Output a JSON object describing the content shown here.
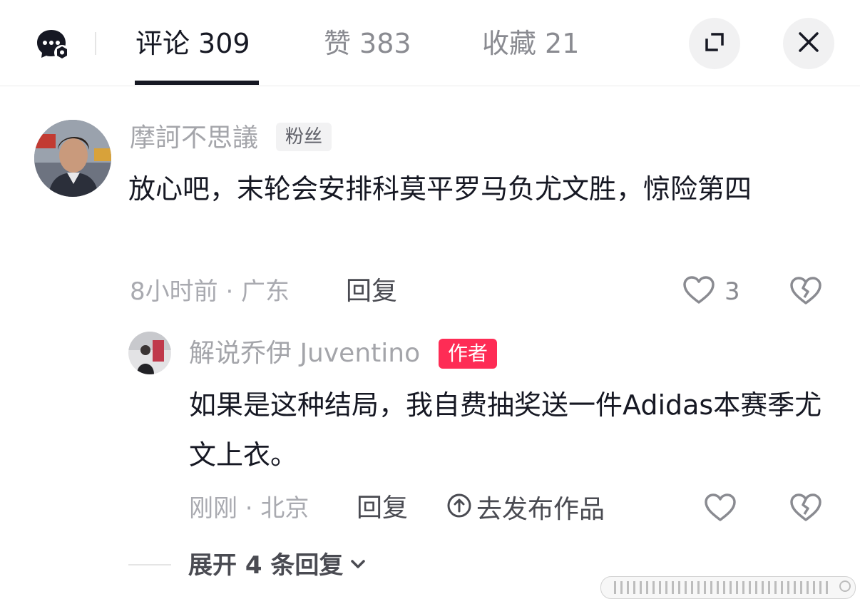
{
  "header": {
    "tabs": [
      {
        "label": "评论",
        "count": "309"
      },
      {
        "label": "赞",
        "count": "383"
      },
      {
        "label": "收藏",
        "count": "21"
      }
    ]
  },
  "comments": [
    {
      "username": "摩訶不思議",
      "badge": "粉丝",
      "text": "放心吧，末轮会安排科莫平罗马负尤文胜，惊险第四",
      "meta": "8小时前 · 广东",
      "reply_label": "回复",
      "like_count": "3"
    }
  ],
  "reply": {
    "username": "解说乔伊 Juventino",
    "badge": "作者",
    "text": "如果是这种结局，我自费抽奖送一件Adidas本赛季尤文上衣。",
    "meta": "刚刚 · 北京",
    "reply_label": "回复",
    "publish_label": "去发布作品"
  },
  "expand_label": "展开 4 条回复",
  "colors": {
    "author_badge": "#fe2c55",
    "text_primary": "#161823",
    "text_secondary": "#a4a5aa"
  },
  "icons": [
    "chat-settings-icon",
    "expand-icon",
    "close-icon",
    "heart-icon",
    "broken-heart-icon",
    "upload-circle-icon",
    "chevron-down-icon"
  ]
}
